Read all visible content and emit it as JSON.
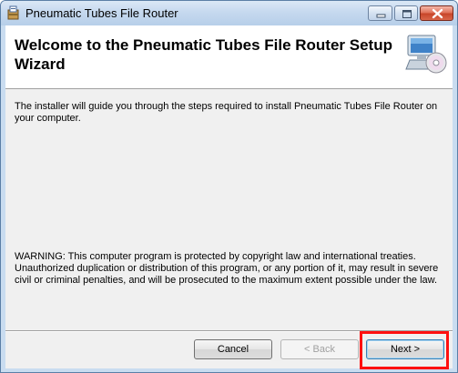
{
  "window": {
    "title": "Pneumatic Tubes File Router",
    "app_icon": "installer-icon",
    "controls": {
      "minimize": "minimize-icon",
      "maximize": "maximize-icon",
      "close": "close-icon"
    }
  },
  "header": {
    "title": "Welcome to the Pneumatic Tubes File Router Setup Wizard",
    "icon": "computer-cd-icon"
  },
  "body": {
    "intro": "The installer will guide you through the steps required to install Pneumatic Tubes File Router on your computer.",
    "warning": "WARNING: This computer program is protected by copyright law and international treaties. Unauthorized duplication or distribution of this program, or any portion of it, may result in severe civil or criminal penalties, and will be prosecuted to the maximum extent possible under the law."
  },
  "buttons": {
    "cancel": "Cancel",
    "back": "< Back",
    "next": "Next >"
  },
  "colors": {
    "highlight": "#ff1010",
    "titlebar": "#c6d9ef"
  }
}
